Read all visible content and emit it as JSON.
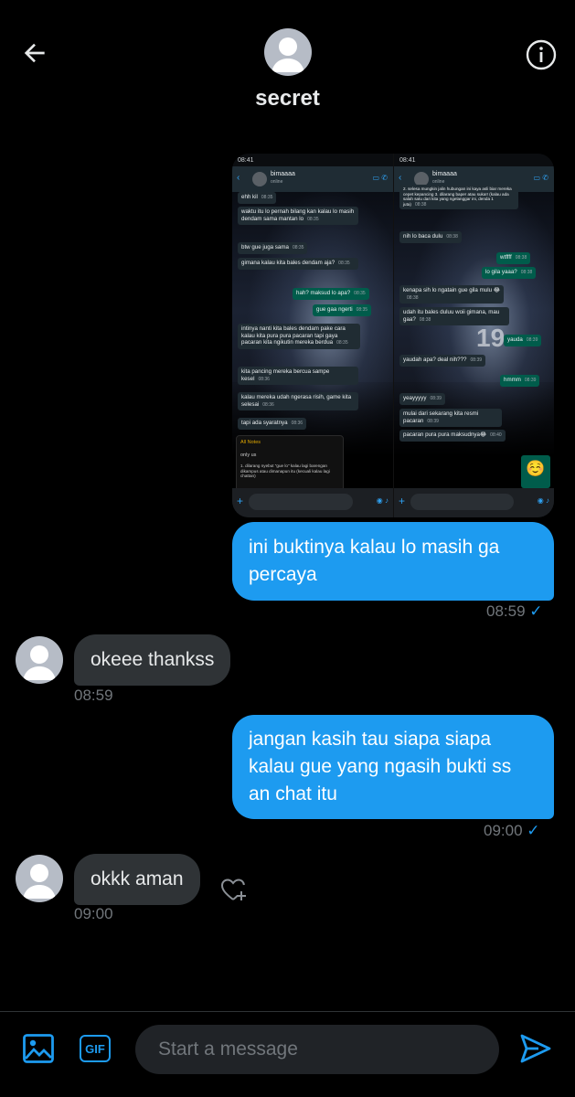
{
  "header": {
    "title": "secret",
    "back_icon": "arrow-left-icon",
    "info_icon": "info-icon"
  },
  "attachment": {
    "left_phone": {
      "time": "08:41",
      "contact": "bimaaaa",
      "status": "online",
      "messages": [
        {
          "dir": "in",
          "text": "ehh kil",
          "time": "08:35"
        },
        {
          "dir": "in",
          "text": "waktu itu lo pernah bilang kan kalau lo masih dendam sama mantan lo",
          "time": "08:35"
        },
        {
          "dir": "in",
          "text": "btw gue juga sama",
          "time": "08:35"
        },
        {
          "dir": "in",
          "text": "gimana kalau kita bales dendam aja?",
          "time": "08:35"
        },
        {
          "dir": "out",
          "text": "hah? maksud lo apa?",
          "time": "08:35"
        },
        {
          "dir": "out",
          "text": "gue gaa ngerti",
          "time": "08:35"
        },
        {
          "dir": "in",
          "text": "intinya nanti kita bales dendam pake cara kalau kita pura pura pacaran tapi gaya pacaran kita ngikutin mereka berdua",
          "time": "08:35"
        },
        {
          "dir": "in",
          "text": "kita pancing mereka bercua sampe kesel",
          "time": "08:36"
        },
        {
          "dir": "in",
          "text": "kalau mereka udah ngerasa risih, game kita selesai",
          "time": "08:36"
        },
        {
          "dir": "in",
          "text": "tapi ada syaratnya",
          "time": "08:36"
        }
      ],
      "note": {
        "header": "All Notes",
        "title": "only us",
        "body": "1. dilarang nyebut \"gue lo\" kalau lagi barengan dikampus atau dimanapun itu (kecuali kalau lagi chattan)"
      }
    },
    "right_phone": {
      "time": "08:41",
      "contact": "bimaaaa",
      "status": "online",
      "messages": [
        {
          "dir": "in",
          "text": "2. selesa mungkin jalin hubungan ini kaya asli biar mereka cepet kepancing 3. dilarang baper atau suka!! (kalau ada salah satu dari kita yang ngelanggar ini, denda 1 juta)",
          "time": "08:38"
        },
        {
          "dir": "in",
          "text": "nih lo baca dulu",
          "time": "08:38"
        },
        {
          "dir": "out",
          "text": "wtffff",
          "time": "08:38"
        },
        {
          "dir": "out",
          "text": "lo gila yaaa?",
          "time": "08:38"
        },
        {
          "dir": "in",
          "text": "kenapa sih lo ngatain gue gila mulu 😂",
          "time": "08:38"
        },
        {
          "dir": "in",
          "text": "udah itu bales duluu woii gimana, mau gaa?",
          "time": "08:38"
        },
        {
          "dir": "out",
          "text": "yauda",
          "time": "08:39"
        },
        {
          "dir": "in",
          "text": "yaudah apa? deal nih???",
          "time": "08:39"
        },
        {
          "dir": "out",
          "text": "hmmm",
          "time": "08:39"
        },
        {
          "dir": "in",
          "text": "yeayyyyy",
          "time": "08:39"
        },
        {
          "dir": "in",
          "text": "mulai dari sekarang kita resmi pacaran",
          "time": "08:39"
        },
        {
          "dir": "in",
          "text": "pacaran pura pura maksudnya😂",
          "time": "08:40"
        },
        {
          "dir": "out",
          "text": "☺️",
          "time": "08:40"
        }
      ],
      "big_number": "19"
    }
  },
  "messages": [
    {
      "id": "m1",
      "dir": "sent",
      "text": "ini buktinya kalau lo masih ga percaya",
      "time": "08:59",
      "tick": "✓"
    },
    {
      "id": "m2",
      "dir": "recv",
      "text": "okeee thankss",
      "time": "08:59"
    },
    {
      "id": "m3",
      "dir": "sent",
      "text": "jangan kasih tau siapa siapa kalau gue yang ngasih bukti ss an chat itu",
      "time": "09:00",
      "tick": "✓"
    },
    {
      "id": "m4",
      "dir": "recv",
      "text": "okkk aman",
      "time": "09:00"
    }
  ],
  "composer": {
    "placeholder": "Start a message",
    "gif_label": "GIF",
    "image_icon": "image-icon",
    "send_icon": "send-icon"
  },
  "colors": {
    "accent": "#1d9bf0",
    "background": "#000000",
    "received_bubble": "#2f3336",
    "meta_text": "#71767b"
  }
}
